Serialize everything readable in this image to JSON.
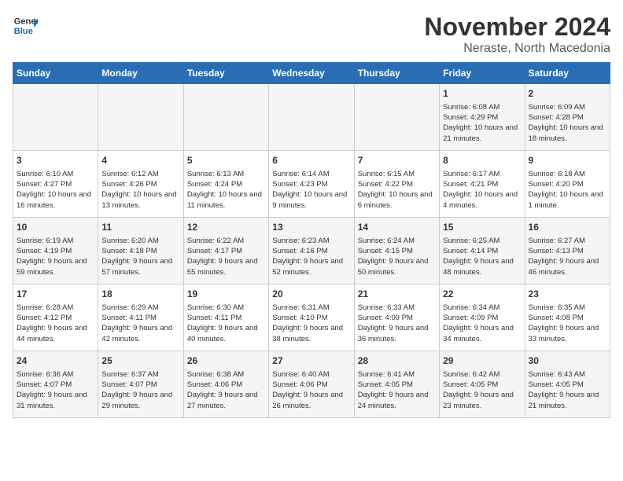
{
  "header": {
    "logo_line1": "General",
    "logo_line2": "Blue",
    "title": "November 2024",
    "subtitle": "Neraste, North Macedonia"
  },
  "columns": [
    "Sunday",
    "Monday",
    "Tuesday",
    "Wednesday",
    "Thursday",
    "Friday",
    "Saturday"
  ],
  "weeks": [
    [
      {
        "day": "",
        "info": ""
      },
      {
        "day": "",
        "info": ""
      },
      {
        "day": "",
        "info": ""
      },
      {
        "day": "",
        "info": ""
      },
      {
        "day": "",
        "info": ""
      },
      {
        "day": "1",
        "info": "Sunrise: 6:08 AM\nSunset: 4:29 PM\nDaylight: 10 hours and 21 minutes."
      },
      {
        "day": "2",
        "info": "Sunrise: 6:09 AM\nSunset: 4:28 PM\nDaylight: 10 hours and 18 minutes."
      }
    ],
    [
      {
        "day": "3",
        "info": "Sunrise: 6:10 AM\nSunset: 4:27 PM\nDaylight: 10 hours and 16 minutes."
      },
      {
        "day": "4",
        "info": "Sunrise: 6:12 AM\nSunset: 4:26 PM\nDaylight: 10 hours and 13 minutes."
      },
      {
        "day": "5",
        "info": "Sunrise: 6:13 AM\nSunset: 4:24 PM\nDaylight: 10 hours and 11 minutes."
      },
      {
        "day": "6",
        "info": "Sunrise: 6:14 AM\nSunset: 4:23 PM\nDaylight: 10 hours and 9 minutes."
      },
      {
        "day": "7",
        "info": "Sunrise: 6:15 AM\nSunset: 4:22 PM\nDaylight: 10 hours and 6 minutes."
      },
      {
        "day": "8",
        "info": "Sunrise: 6:17 AM\nSunset: 4:21 PM\nDaylight: 10 hours and 4 minutes."
      },
      {
        "day": "9",
        "info": "Sunrise: 6:18 AM\nSunset: 4:20 PM\nDaylight: 10 hours and 1 minute."
      }
    ],
    [
      {
        "day": "10",
        "info": "Sunrise: 6:19 AM\nSunset: 4:19 PM\nDaylight: 9 hours and 59 minutes."
      },
      {
        "day": "11",
        "info": "Sunrise: 6:20 AM\nSunset: 4:18 PM\nDaylight: 9 hours and 57 minutes."
      },
      {
        "day": "12",
        "info": "Sunrise: 6:22 AM\nSunset: 4:17 PM\nDaylight: 9 hours and 55 minutes."
      },
      {
        "day": "13",
        "info": "Sunrise: 6:23 AM\nSunset: 4:16 PM\nDaylight: 9 hours and 52 minutes."
      },
      {
        "day": "14",
        "info": "Sunrise: 6:24 AM\nSunset: 4:15 PM\nDaylight: 9 hours and 50 minutes."
      },
      {
        "day": "15",
        "info": "Sunrise: 6:25 AM\nSunset: 4:14 PM\nDaylight: 9 hours and 48 minutes."
      },
      {
        "day": "16",
        "info": "Sunrise: 6:27 AM\nSunset: 4:13 PM\nDaylight: 9 hours and 46 minutes."
      }
    ],
    [
      {
        "day": "17",
        "info": "Sunrise: 6:28 AM\nSunset: 4:12 PM\nDaylight: 9 hours and 44 minutes."
      },
      {
        "day": "18",
        "info": "Sunrise: 6:29 AM\nSunset: 4:11 PM\nDaylight: 9 hours and 42 minutes."
      },
      {
        "day": "19",
        "info": "Sunrise: 6:30 AM\nSunset: 4:11 PM\nDaylight: 9 hours and 40 minutes."
      },
      {
        "day": "20",
        "info": "Sunrise: 6:31 AM\nSunset: 4:10 PM\nDaylight: 9 hours and 38 minutes."
      },
      {
        "day": "21",
        "info": "Sunrise: 6:33 AM\nSunset: 4:09 PM\nDaylight: 9 hours and 36 minutes."
      },
      {
        "day": "22",
        "info": "Sunrise: 6:34 AM\nSunset: 4:09 PM\nDaylight: 9 hours and 34 minutes."
      },
      {
        "day": "23",
        "info": "Sunrise: 6:35 AM\nSunset: 4:08 PM\nDaylight: 9 hours and 33 minutes."
      }
    ],
    [
      {
        "day": "24",
        "info": "Sunrise: 6:36 AM\nSunset: 4:07 PM\nDaylight: 9 hours and 31 minutes."
      },
      {
        "day": "25",
        "info": "Sunrise: 6:37 AM\nSunset: 4:07 PM\nDaylight: 9 hours and 29 minutes."
      },
      {
        "day": "26",
        "info": "Sunrise: 6:38 AM\nSunset: 4:06 PM\nDaylight: 9 hours and 27 minutes."
      },
      {
        "day": "27",
        "info": "Sunrise: 6:40 AM\nSunset: 4:06 PM\nDaylight: 9 hours and 26 minutes."
      },
      {
        "day": "28",
        "info": "Sunrise: 6:41 AM\nSunset: 4:05 PM\nDaylight: 9 hours and 24 minutes."
      },
      {
        "day": "29",
        "info": "Sunrise: 6:42 AM\nSunset: 4:05 PM\nDaylight: 9 hours and 23 minutes."
      },
      {
        "day": "30",
        "info": "Sunrise: 6:43 AM\nSunset: 4:05 PM\nDaylight: 9 hours and 21 minutes."
      }
    ]
  ]
}
